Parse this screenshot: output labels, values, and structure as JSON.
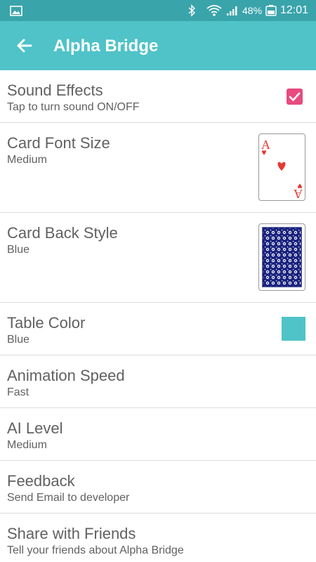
{
  "status_bar": {
    "battery": "48%",
    "time": "12:01"
  },
  "app_bar": {
    "title": "Alpha Bridge"
  },
  "settings": [
    {
      "title": "Sound Effects",
      "summary": "Tap to turn sound ON/OFF",
      "control": "checkbox",
      "checked": true
    },
    {
      "title": "Card Font Size",
      "summary": "Medium",
      "control": "card-face",
      "card_rank": "A",
      "card_suit": "♥"
    },
    {
      "title": "Card Back Style",
      "summary": "Blue",
      "control": "card-back"
    },
    {
      "title": "Table Color",
      "summary": "Blue",
      "control": "color-swatch",
      "color": "#4fc3c8"
    },
    {
      "title": "Animation Speed",
      "summary": "Fast"
    },
    {
      "title": "AI Level",
      "summary": "Medium"
    },
    {
      "title": "Feedback",
      "summary": "Send Email to developer"
    },
    {
      "title": "Share with Friends",
      "summary": "Tell your friends about Alpha Bridge"
    }
  ],
  "colors": {
    "status_bar": "#3aa4ab",
    "app_bar": "#4fc3c8",
    "checkbox": "#e84a7f",
    "card_red": "#e53935",
    "card_back_blue": "#1a237e"
  }
}
